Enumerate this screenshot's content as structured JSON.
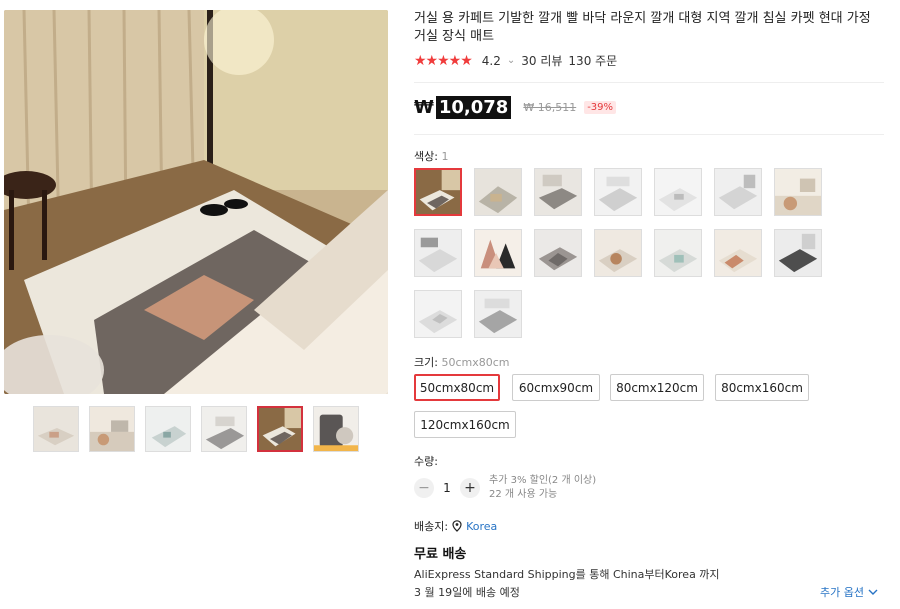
{
  "product": {
    "title": "거실 용 카페트 기발한 깔개 빨 바닥 라운지 깔개 대형 지역 깔개 침실 카펫 현대 가정 거실 장식 매트",
    "rating": "4.2",
    "reviews": "30 리뷰",
    "orders": "130 주문",
    "stars": "★★★★★"
  },
  "price": {
    "currency_symbol": "₩",
    "current": "10,078",
    "original": "₩ 16,511",
    "discount": "-39%"
  },
  "color": {
    "label": "색상:",
    "selected": "1",
    "swatches": [
      "rug-1",
      "rug-2",
      "rug-3",
      "rug-4",
      "rug-5",
      "rug-6",
      "rug-7",
      "rug-8",
      "rug-9",
      "rug-10",
      "rug-11",
      "rug-12",
      "rug-13",
      "rug-14",
      "rug-15",
      "rug-16"
    ]
  },
  "size": {
    "label": "크기:",
    "selected": "50cmx80cm",
    "options": [
      "50cmx80cm",
      "60cmx90cm",
      "80cmx120cm",
      "80cmx160cm",
      "120cmx160cm"
    ]
  },
  "quantity": {
    "label": "수량:",
    "value": "1",
    "minus": "−",
    "plus": "+",
    "note1": "추가 3% 할인(2 개 이상)",
    "note2": "22 개 사용 가능"
  },
  "shipping": {
    "to_label": "배송지:",
    "country": "Korea",
    "free": "무료 배송",
    "desc": "AliExpress Standard Shipping를 통해 China부터Korea 까지",
    "date": "3 월 19일에 배송 예정",
    "more": "추가 옵션"
  },
  "colors": {
    "accent": "#e4393c",
    "star": "#f03c3c",
    "link": "#2874c5"
  }
}
